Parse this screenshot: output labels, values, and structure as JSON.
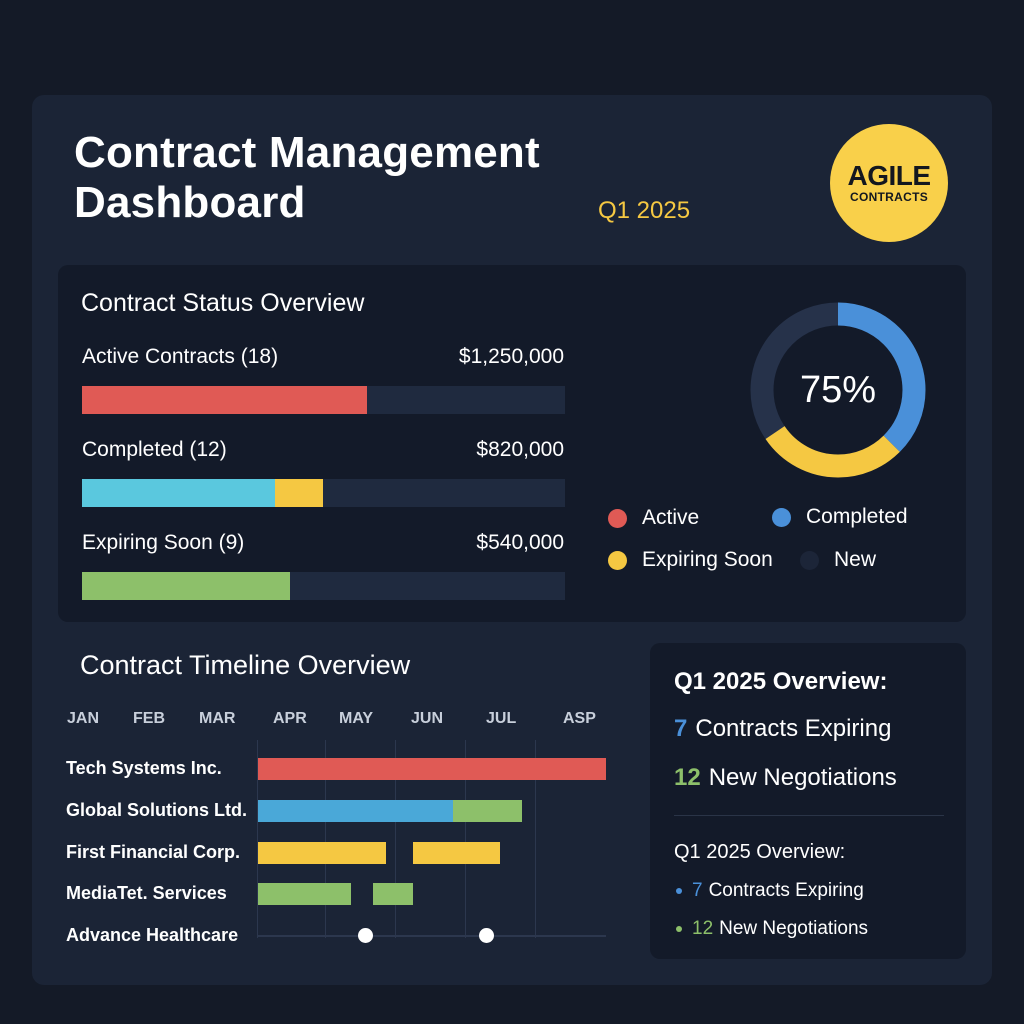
{
  "header": {
    "title_line1": "Contract Management",
    "title_line2": "Dashboard",
    "period": "Q1 2025",
    "logo_main": "AGILE",
    "logo_sub": "CONTRACTS"
  },
  "colors": {
    "active": "#e05a55",
    "completed": "#5ac8de",
    "expiring": "#f5c842",
    "new": "#8dc06a",
    "donut_blue": "#4a90d9",
    "donut_dark": "#26324a",
    "accent_yellow": "#f5c842",
    "accent_blue": "#4a90d9",
    "accent_green": "#8dc06a"
  },
  "status": {
    "heading": "Contract Status Overview",
    "rows": [
      {
        "label": "Active Contracts (18)",
        "amount": "$1,250,000",
        "fill": [
          0.59
        ]
      },
      {
        "label": "Completed (12)",
        "amount": "$820,000",
        "fill": [
          0.4,
          0.1
        ]
      },
      {
        "label": "Expiring Soon (9)",
        "amount": "$540,000",
        "fill": [
          0.43
        ]
      }
    ],
    "donut_percent": "75%",
    "donut_segments": [
      {
        "series": "completed",
        "fraction": 0.375
      },
      {
        "series": "expiring",
        "fraction": 0.28
      },
      {
        "series": "dark",
        "fraction": 0.345
      }
    ],
    "legend": [
      {
        "label": "Active",
        "color": "#e05a55"
      },
      {
        "label": "Completed",
        "color": "#4a90d9"
      },
      {
        "label": "Expiring Soon",
        "color": "#f5c842"
      },
      {
        "label": "New",
        "color": "#1c2538"
      }
    ]
  },
  "timeline": {
    "heading": "Contract Timeline Overview",
    "months": [
      "JAN",
      "FEB",
      "MAR",
      "APR",
      "MAY",
      "JUN",
      "JUL",
      "ASP"
    ],
    "rows": [
      {
        "label": "Tech Systems Inc."
      },
      {
        "label": "Global Solutions Ltd."
      },
      {
        "label": "First Financial Corp."
      },
      {
        "label": "MediaTet. Services"
      },
      {
        "label": "Advance Healthcare"
      }
    ]
  },
  "overview": {
    "title": "Q1 2025 Overview:",
    "expiring_num": "7",
    "expiring_label": "Contracts Expiring",
    "negotiations_num": "12",
    "negotiations_label": "New Negotiations",
    "title2": "Q1 2025 Overview:",
    "item1_num": "7",
    "item1_label": "Contracts Expiring",
    "item2_num": "12",
    "item2_label": "New Negotiations"
  }
}
